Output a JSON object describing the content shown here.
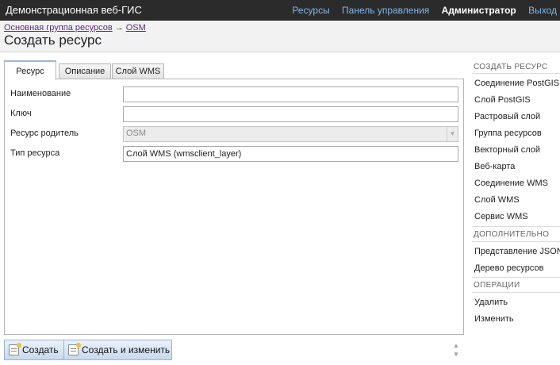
{
  "app_title": "Демонстрационная веб-ГИС",
  "topnav": {
    "resources": "Ресурсы",
    "control_panel": "Панель управления",
    "user": "Администратор",
    "logout": "Выход"
  },
  "breadcrumb": {
    "items": [
      "Основная группа ресурсов",
      "OSM"
    ],
    "separator": "→"
  },
  "page_title": "Создать ресурс",
  "tabs": [
    {
      "label": "Ресурс",
      "active": true
    },
    {
      "label": "Описание",
      "active": false
    },
    {
      "label": "Слой WMS",
      "active": false
    }
  ],
  "form": {
    "name_label": "Наименование",
    "name_value": "",
    "key_label": "Ключ",
    "key_value": "",
    "parent_label": "Ресурс родитель",
    "parent_value": "OSM",
    "type_label": "Тип ресурса",
    "type_value": "Слой WMS (wmsclient_layer)"
  },
  "buttons": {
    "create": "Создать",
    "create_and_edit": "Создать и изменить"
  },
  "sidebar": {
    "create_heading": "СОЗДАТЬ РЕСУРС",
    "create_items": [
      "Соединение PostGIS",
      "Слой PostGIS",
      "Растровый слой",
      "Группа ресурсов",
      "Векторный слой",
      "Веб-карта",
      "Соединение WMS",
      "Слой WMS",
      "Сервис WMS"
    ],
    "extra_heading": "ДОПОЛНИТЕЛЬНО",
    "extra_items": [
      "Представление JSON",
      "Дерево ресурсов"
    ],
    "ops_heading": "ОПЕРАЦИИ",
    "ops_items": [
      "Удалить",
      "Изменить"
    ]
  },
  "colors": {
    "topbar": "#2b2b2b",
    "nav_link": "#7fb6e6",
    "breadcrumb_link": "#5a2d82",
    "button_bg": "#c7d9ec"
  },
  "icons": {
    "create_button": "new-document-icon",
    "create_edit_button": "new-document-icon",
    "select": "chevron-down-icon",
    "scroll": "scroll-up-down-icon"
  }
}
